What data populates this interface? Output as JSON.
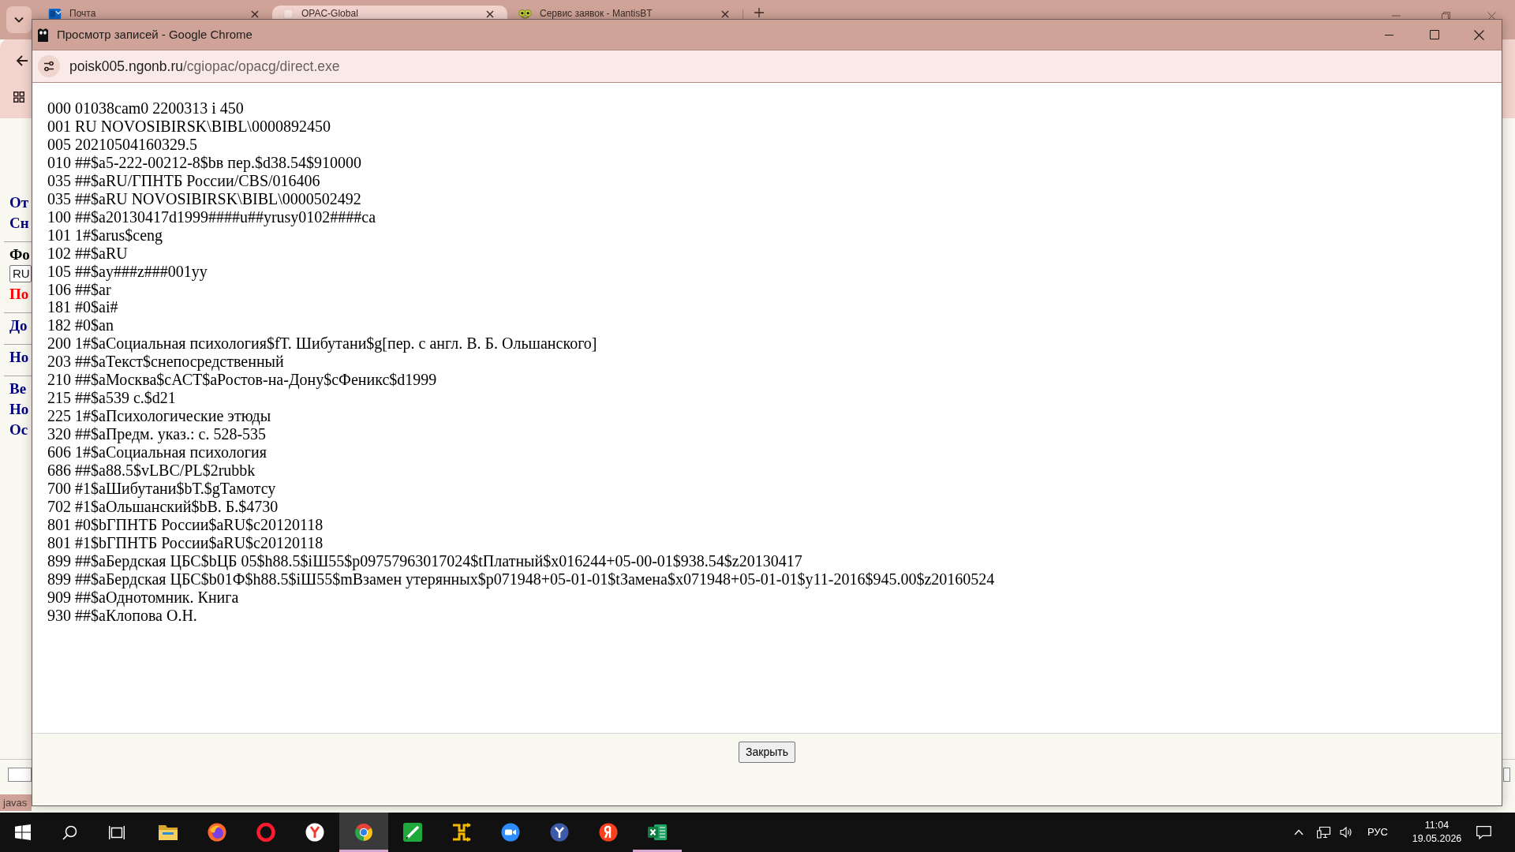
{
  "browser": {
    "tabs": [
      {
        "kind": "mail",
        "title": "Почта",
        "selected": false
      },
      {
        "kind": "page",
        "title": "OPAC-Global",
        "selected": true
      },
      {
        "kind": "bug",
        "title": "Сервис заявок - MantisBT",
        "selected": false
      }
    ]
  },
  "page": {
    "sidebar_groups": [
      {
        "items": [
          {
            "kind": "link",
            "text": "От"
          },
          {
            "kind": "link",
            "text": "Сн"
          }
        ]
      },
      {
        "items": [
          {
            "kind": "label",
            "text": "Фо"
          },
          {
            "kind": "select",
            "text": "RU"
          },
          {
            "kind": "alert",
            "text": "По"
          }
        ]
      },
      {
        "items": [
          {
            "kind": "link",
            "text": "До"
          }
        ]
      },
      {
        "items": [
          {
            "kind": "link",
            "text": "Но"
          }
        ]
      },
      {
        "items": [
          {
            "kind": "link",
            "text": "Ве"
          },
          {
            "kind": "link",
            "text": "Но"
          },
          {
            "kind": "link",
            "text": "Ос"
          }
        ]
      }
    ],
    "status_text": "javas"
  },
  "popup": {
    "title": "Просмотр записей - Google Chrome",
    "url": {
      "host": "poisk005.ngonb.ru",
      "path": "/cgiopac/opacg/direct.exe"
    },
    "record_lines": [
      "000 01038cam0 2200313 i 450",
      "001 RU NOVOSIBIRSK\\BIBL\\0000892450",
      "005 20210504160329.5",
      "010 ##$a5-222-00212-8$bв пер.$d38.54$910000",
      "035 ##$aRU/ГПНТБ России/CBS/016406",
      "035 ##$aRU NOVOSIBIRSK\\BIBL\\0000502492",
      "100 ##$a20130417d1999####u##yrusy0102####ca",
      "101 1#$arus$ceng",
      "102 ##$aRU",
      "105 ##$ay###z###001yy",
      "106 ##$ar",
      "181 #0$ai#",
      "182 #0$an",
      "200 1#$aСоциальная психология$fТ. Шибутани$g[пер. с англ. В. Б. Ольшанского]",
      "203 ##$aТекст$cнепосредственный",
      "210 ##$aМосква$cАСТ$aРостов-на-Дону$cФеникс$d1999",
      "215 ##$a539 с.$d21",
      "225 1#$aПсихологические этюды",
      "320 ##$aПредм. указ.: с. 528-535",
      "606 1#$aСоциальная психология",
      "686 ##$a88.5$vLBC/PL$2rubbk",
      "700 #1$aШибутани$bТ.$gТамотсу",
      "702 #1$aОльшанский$bВ. Б.$4730",
      "801 #0$bГПНТБ России$aRU$c20120118",
      "801 #1$bГПНТБ России$aRU$c20120118",
      "899 ##$aБердская ЦБС$bЦБ 05$h88.5$iШ55$p09757963017024$tПлатный$x016244+05-00-01$938.54$z20130417",
      "899 ##$aБердская ЦБС$b01Ф$h88.5$iШ55$mВзамен утерянных$p071948+05-01-01$tЗамена$x071948+05-01-01$y11-2016$945.00$z20160524",
      "909 ##$aОднотомник. Книга",
      "930 ##$aКлопова О.Н."
    ],
    "close_button": "Закрыть"
  },
  "taskbar": {
    "apps": [
      {
        "kind": "folder",
        "running": false,
        "selected": false
      },
      {
        "kind": "firefox",
        "running": false,
        "selected": false
      },
      {
        "kind": "opera",
        "running": false,
        "selected": false
      },
      {
        "kind": "ybrowser",
        "running": false,
        "selected": false
      },
      {
        "kind": "chrome",
        "running": true,
        "selected": true
      },
      {
        "kind": "pen",
        "running": false,
        "selected": false
      },
      {
        "kind": "arrows",
        "running": false,
        "selected": false
      },
      {
        "kind": "camera",
        "running": false,
        "selected": false
      },
      {
        "kind": "ycircle",
        "running": false,
        "selected": false
      },
      {
        "kind": "ya",
        "running": false,
        "selected": false
      },
      {
        "kind": "sheet",
        "running": true,
        "selected": false
      }
    ],
    "language": "РУС",
    "time": "11:04",
    "date": "19.05.2026"
  }
}
